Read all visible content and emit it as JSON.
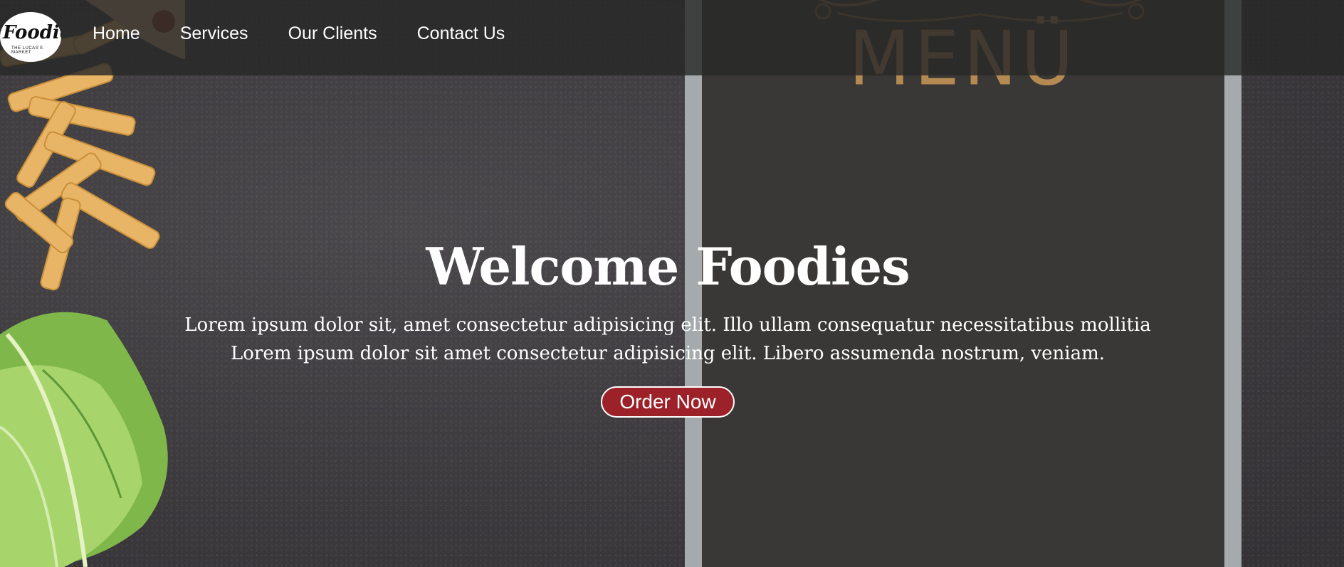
{
  "brand": {
    "logo_name": "Foodies",
    "logo_tagline": "THE LUCAS'S MARKET"
  },
  "nav": {
    "items": [
      {
        "label": "Home"
      },
      {
        "label": "Services"
      },
      {
        "label": "Our Clients"
      },
      {
        "label": "Contact Us"
      }
    ]
  },
  "background": {
    "menu_board_title": "MENÜ"
  },
  "hero": {
    "title": "Welcome Foodies",
    "text_line1": "Lorem ipsum dolor sit, amet consectetur adipisicing elit. Illo ullam consequatur necessitatibus mollitia",
    "text_line2": "Lorem ipsum dolor sit amet consectetur adipisicing elit. Libero assumenda nostrum, veniam.",
    "cta_label": "Order Now"
  },
  "colors": {
    "nav_overlay": "#282828",
    "cta_background": "#9c2129",
    "menu_title": "#b48a52",
    "text": "#ffffff"
  }
}
